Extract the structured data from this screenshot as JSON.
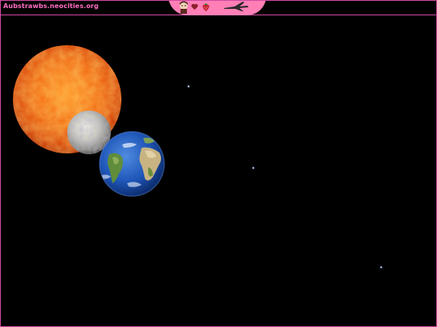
{
  "header": {
    "site_url": "Aubstrawbs.neocities.org"
  },
  "banner": {
    "decorations": [
      "character-sprite-icon",
      "heart-sticker-icon",
      "strawberry-icon",
      "airplane-icon"
    ]
  },
  "scene": {
    "background": "#000000",
    "bodies": [
      "sun",
      "moon",
      "earth"
    ],
    "star_count": 3
  },
  "colors": {
    "accent": "#ff6fc2",
    "frame": "#d04aa0",
    "banner": "#ff7fb6"
  }
}
